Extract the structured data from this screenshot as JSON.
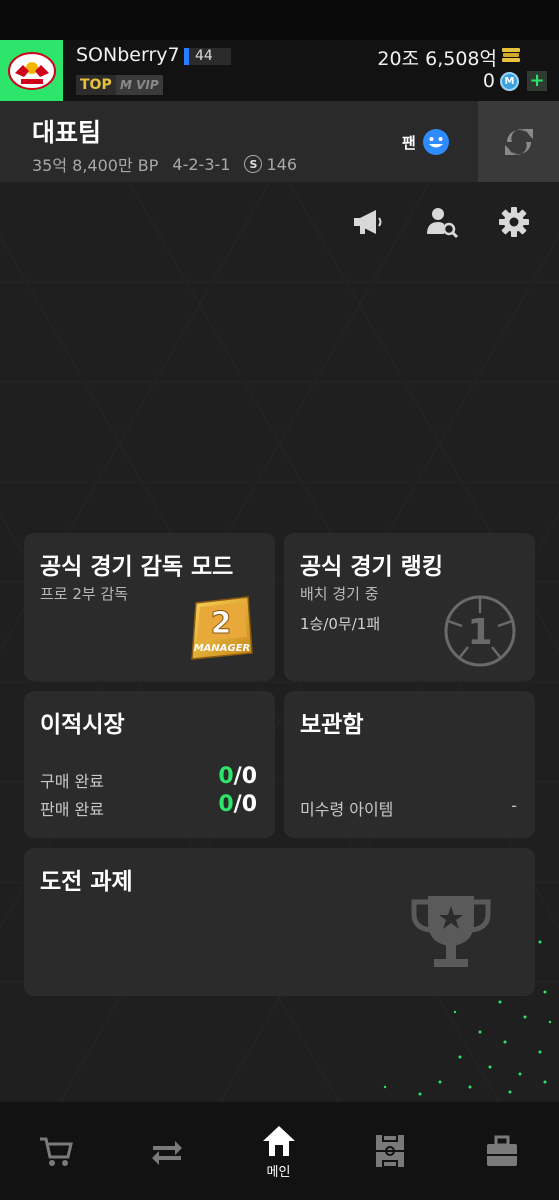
{
  "header": {
    "user_name": "SONberry7",
    "level": "44",
    "top_badge": "TOP",
    "vip_badge": "M VIP",
    "bp_balance": "20조 6,508억",
    "m_balance": "0",
    "m_icon_letter": "M",
    "add_label": "+"
  },
  "team": {
    "title": "대표팀",
    "value": "35억 8,400만 BP",
    "formation": "4-2-3-1",
    "salary_icon": "S",
    "salary": "146",
    "fan_label": "팬"
  },
  "cards": {
    "manager": {
      "title": "공식 경기 감독 모드",
      "subtitle": "프로 2부 감독",
      "badge_number": "2",
      "badge_text": "MANAGER"
    },
    "ranking": {
      "title": "공식 경기 랭킹",
      "subtitle": "배치 경기 중",
      "record": "1승/0무/1패",
      "badge_number": "1"
    },
    "transfer": {
      "title": "이적시장",
      "buy_label": "구매 완료",
      "buy_done": "0",
      "buy_total": "/0",
      "sell_label": "판매 완료",
      "sell_done": "0",
      "sell_total": "/0"
    },
    "storage": {
      "title": "보관함",
      "unclaimed_label": "미수령 아이템",
      "unclaimed_value": "-"
    },
    "challenge": {
      "title": "도전 과제"
    }
  },
  "nav": {
    "home_label": "메인",
    "icons": [
      "cart-icon",
      "transfer-icon",
      "home-icon",
      "pitch-icon",
      "bag-icon"
    ]
  },
  "colors": {
    "accent": "#2de56a",
    "background": "#1f1f1f",
    "card": "#2b2b2b",
    "gold": "#e7c23d"
  }
}
